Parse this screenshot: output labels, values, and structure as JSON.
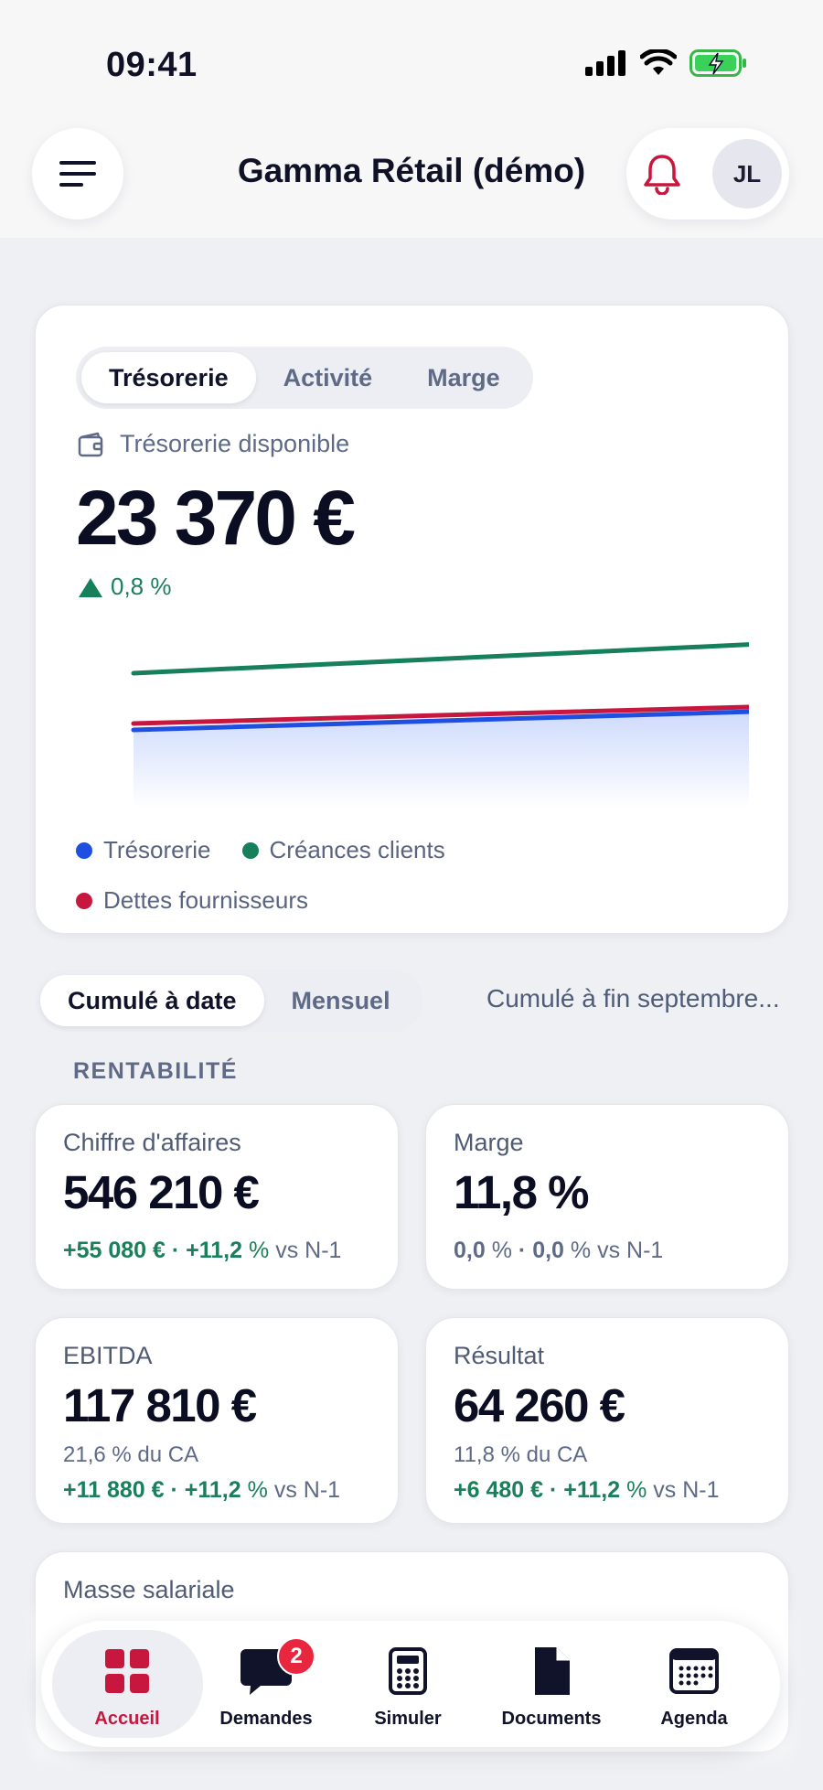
{
  "status_bar": {
    "time": "09:41"
  },
  "header": {
    "title": "Gamma Rétail (démo)",
    "avatar_initials": "JL"
  },
  "treasury": {
    "tabs": [
      "Trésorerie",
      "Activité",
      "Marge"
    ],
    "active_tab": "Trésorerie",
    "label": "Trésorerie disponible",
    "value": "23 370 €",
    "delta": "0,8 %",
    "legend": [
      "Trésorerie",
      "Créances clients",
      "Dettes fournisseurs"
    ],
    "colors": {
      "tresorerie": "#1f4fe0",
      "creances": "#15805a",
      "dettes": "#c8173f"
    }
  },
  "period": {
    "tabs": [
      "Cumulé à date",
      "Mensuel"
    ],
    "active_tab": "Cumulé à date",
    "caption": "Cumulé à fin septembre..."
  },
  "section": {
    "rentabilite": "RENTABILITÉ"
  },
  "kpis": {
    "ca": {
      "title": "Chiffre d'affaires",
      "value": "546 210 €",
      "delta_abs": "+55 080 €",
      "sep": "·",
      "delta_pct": "+11,2",
      "unit": "%",
      "suffix": "vs N-1"
    },
    "marge": {
      "title": "Marge",
      "value": "11,8 %",
      "delta_abs": "0,0",
      "delta_abs_unit": "%",
      "sep": "·",
      "delta_pct": "0,0",
      "unit": "%",
      "suffix": "vs N-1"
    },
    "ebitda": {
      "title": "EBITDA",
      "value": "117 810 €",
      "sub": "21,6 % du CA",
      "delta_abs": "+11 880 €",
      "sep": "·",
      "delta_pct": "+11,2",
      "unit": "%",
      "suffix": "vs N-1"
    },
    "resultat": {
      "title": "Résultat",
      "value": "64 260 €",
      "sub": "11,8 % du CA",
      "delta_abs": "+6 480 €",
      "sep": "·",
      "delta_pct": "+11,2",
      "unit": "%",
      "suffix": "vs N-1"
    },
    "masse": {
      "title": "Masse salariale"
    }
  },
  "nav": {
    "items": [
      "Accueil",
      "Demandes",
      "Simuler",
      "Documents",
      "Agenda"
    ],
    "active": "Accueil",
    "demandes_badge": "2"
  }
}
